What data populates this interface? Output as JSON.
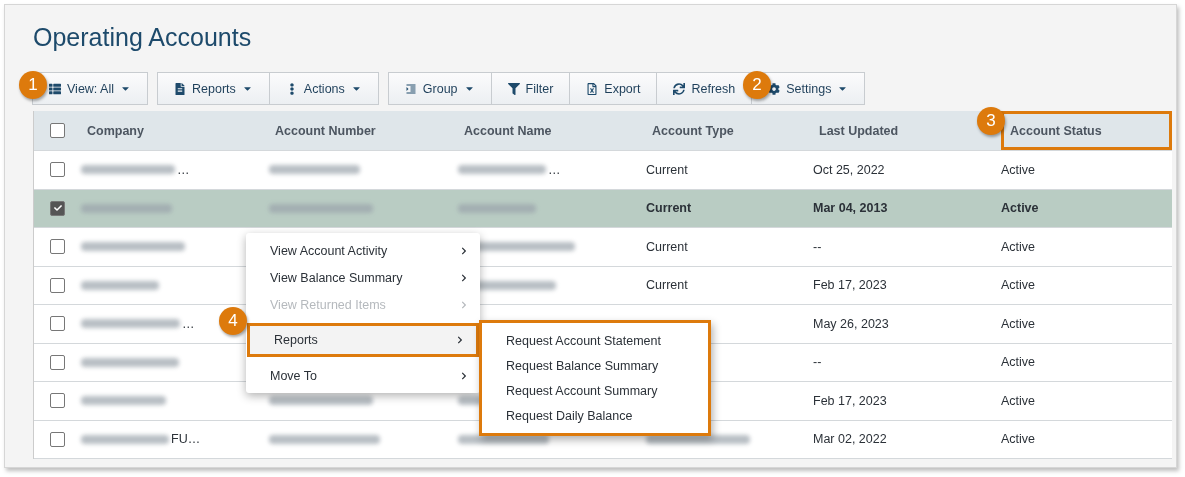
{
  "page": {
    "title": "Operating Accounts"
  },
  "toolbar": [
    {
      "buttons": [
        {
          "label": "View: All",
          "dropdown": true
        }
      ]
    },
    {
      "buttons": [
        {
          "label": "Reports",
          "dropdown": true
        },
        {
          "label": "Actions",
          "dropdown": true
        }
      ]
    },
    {
      "buttons": [
        {
          "label": "Group",
          "dropdown": true
        },
        {
          "label": "Filter",
          "dropdown": false
        },
        {
          "label": "Export",
          "dropdown": false
        },
        {
          "label": "Refresh",
          "dropdown": false
        },
        {
          "label": "Settings",
          "dropdown": true
        }
      ]
    }
  ],
  "table": {
    "all_checked": false,
    "columns": [
      {
        "label": "Company",
        "highlighted": false
      },
      {
        "label": "Account Number",
        "highlighted": false
      },
      {
        "label": "Account Name",
        "highlighted": false
      },
      {
        "label": "Account Type",
        "highlighted": false
      },
      {
        "label": "Last Updated",
        "highlighted": false
      },
      {
        "label": "Account Status",
        "highlighted": true
      }
    ],
    "rows": [
      {
        "selected": false,
        "checked": false,
        "cells": [
          {
            "kind": "blurred",
            "visible_tail": "…"
          },
          {
            "kind": "blurred"
          },
          {
            "kind": "blurred",
            "visible_tail": "…"
          },
          "Current",
          "Oct 25, 2022",
          "Active"
        ]
      },
      {
        "selected": true,
        "checked": true,
        "cells": [
          {
            "kind": "blurred"
          },
          {
            "kind": "blurred"
          },
          {
            "kind": "blurred"
          },
          "Current",
          "Mar 04, 2013",
          "Active"
        ]
      },
      {
        "selected": false,
        "checked": false,
        "cells": [
          {
            "kind": "blurred"
          },
          null,
          {
            "kind": "blurred"
          },
          "Current",
          "--",
          "Active"
        ]
      },
      {
        "selected": false,
        "checked": false,
        "cells": [
          {
            "kind": "blurred"
          },
          null,
          {
            "kind": "blurred"
          },
          "Current",
          "Feb 17, 2023",
          "Active"
        ]
      },
      {
        "selected": false,
        "checked": false,
        "cells": [
          {
            "kind": "blurred",
            "visible_tail": "…"
          },
          null,
          null,
          null,
          "May 26, 2023",
          "Active"
        ]
      },
      {
        "selected": false,
        "checked": false,
        "cells": [
          {
            "kind": "blurred"
          },
          null,
          null,
          null,
          "--",
          "Active"
        ]
      },
      {
        "selected": false,
        "checked": false,
        "cells": [
          {
            "kind": "blurred"
          },
          {
            "kind": "blurred"
          },
          {
            "kind": "blurred"
          },
          null,
          "Feb 17, 2023",
          "Active"
        ]
      },
      {
        "selected": false,
        "checked": false,
        "cells": [
          {
            "kind": "blurred",
            "visible_tail": "FU…"
          },
          {
            "kind": "blurred"
          },
          {
            "kind": "blurred"
          },
          {
            "kind": "blurred"
          },
          "Mar 02, 2022",
          "Active"
        ]
      }
    ]
  },
  "context_menu": {
    "items": [
      {
        "label": "View Account Activity",
        "disabled": false,
        "selected": false,
        "highlighted": false
      },
      {
        "label": "View Balance Summary",
        "disabled": false,
        "selected": false,
        "highlighted": false
      },
      {
        "label": "View Returned Items",
        "disabled": true,
        "selected": false,
        "highlighted": false
      },
      {
        "label": "Reports",
        "disabled": false,
        "selected": true,
        "highlighted": true
      },
      {
        "label": "Move To",
        "disabled": false,
        "selected": false,
        "highlighted": false
      }
    ],
    "submenu": {
      "highlighted": true,
      "items": [
        "Request Account Statement",
        "Request Balance Summary",
        "Request Account Summary",
        "Request Daily Balance"
      ]
    }
  },
  "callouts": [
    "1",
    "2",
    "3",
    "4"
  ]
}
